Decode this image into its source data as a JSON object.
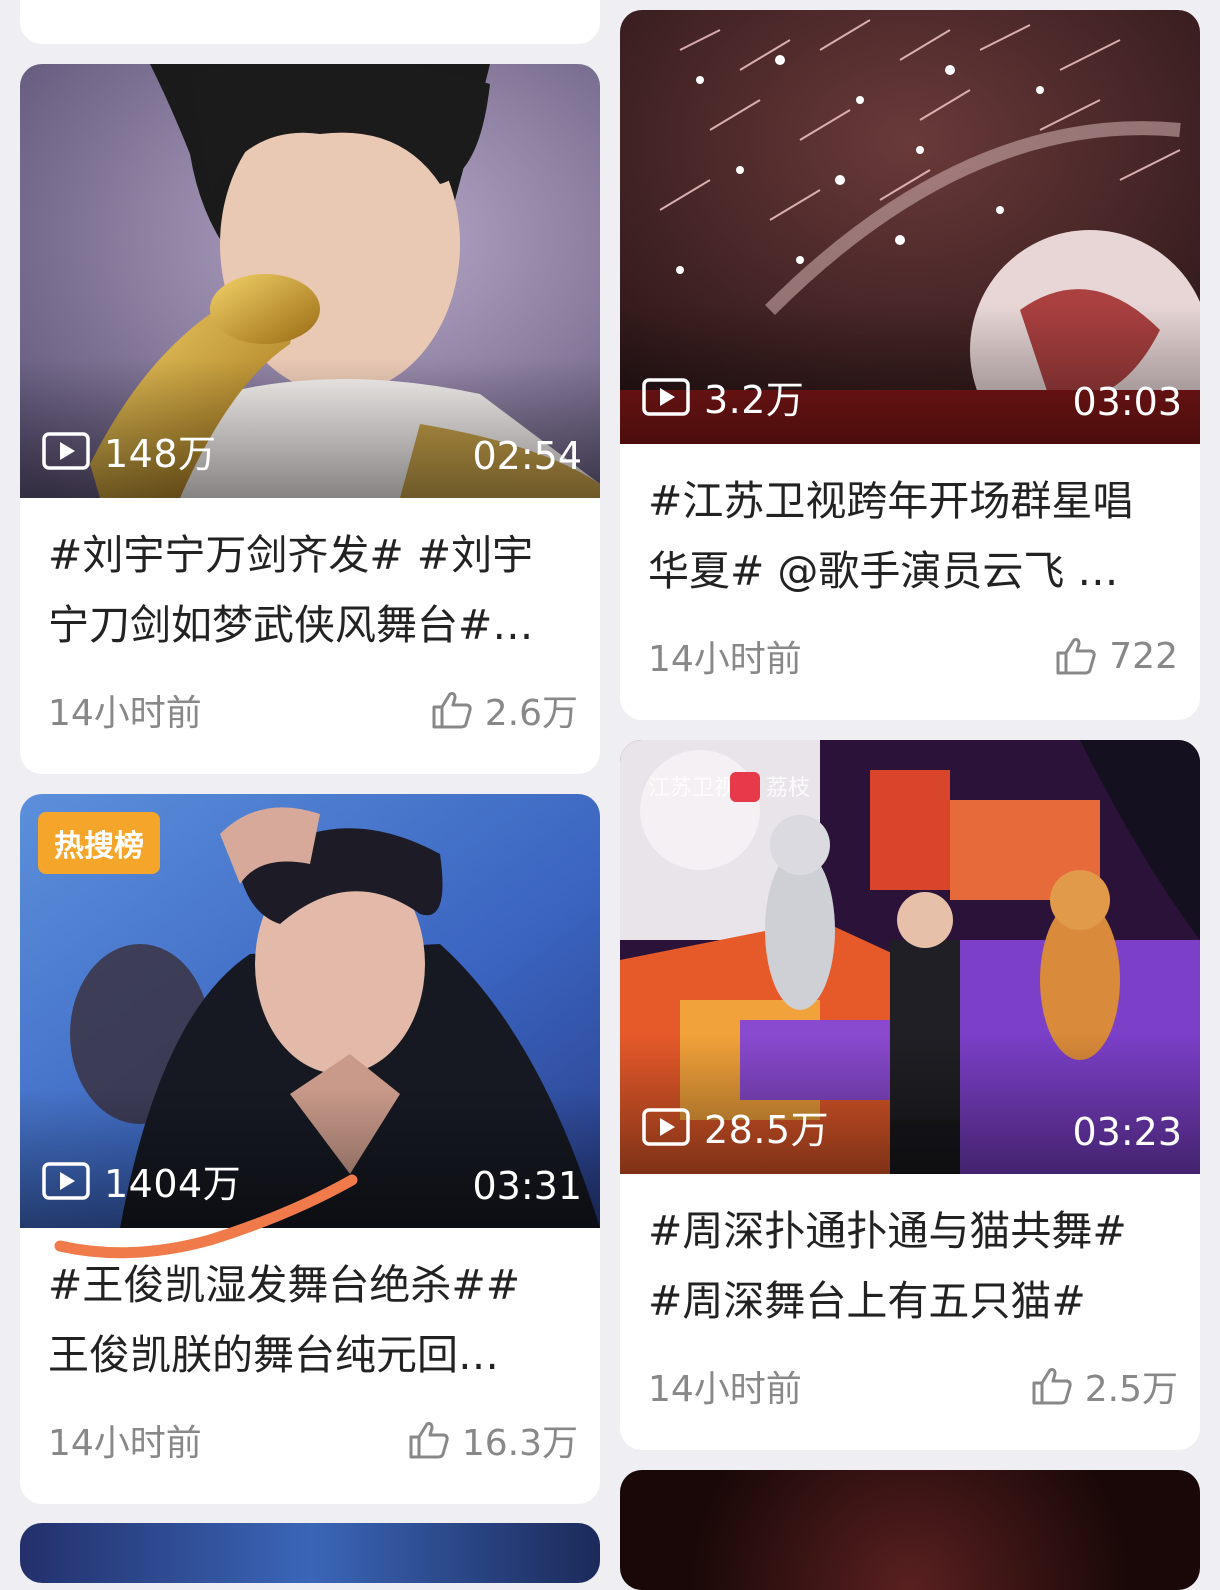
{
  "cards": [
    {
      "views": "148万",
      "duration": "02:54",
      "title_line1": "#刘宇宁万剑齐发# #刘宇",
      "title_line2": "宁刀剑如梦武侠风舞台#…",
      "time": "14小时前",
      "likes": "2.6万"
    },
    {
      "views": "3.2万",
      "duration": "03:03",
      "title_line1": "#江苏卫视跨年开场群星唱",
      "title_line2": "华夏# @歌手演员云飞 …",
      "time": "14小时前",
      "likes": "722"
    },
    {
      "badge": "热搜榜",
      "views": "1404万",
      "duration": "03:31",
      "title_line1": "#王俊凯湿发舞台绝杀##",
      "title_line2": "王俊凯朕的舞台纯元回…",
      "time": "14小时前",
      "likes": "16.3万"
    },
    {
      "watermark1": "江苏卫视",
      "watermark2": "荔枝",
      "views": "28.5万",
      "duration": "03:23",
      "title_line1": "#周深扑通扑通与猫共舞#",
      "title_line2": "#周深舞台上有五只猫#",
      "time": "14小时前",
      "likes": "2.5万"
    }
  ],
  "icons": {
    "play": "play-icon",
    "like": "thumbs-up-icon"
  },
  "colors": {
    "badge": "#f5a62a",
    "annotation": "#f07a4a"
  }
}
